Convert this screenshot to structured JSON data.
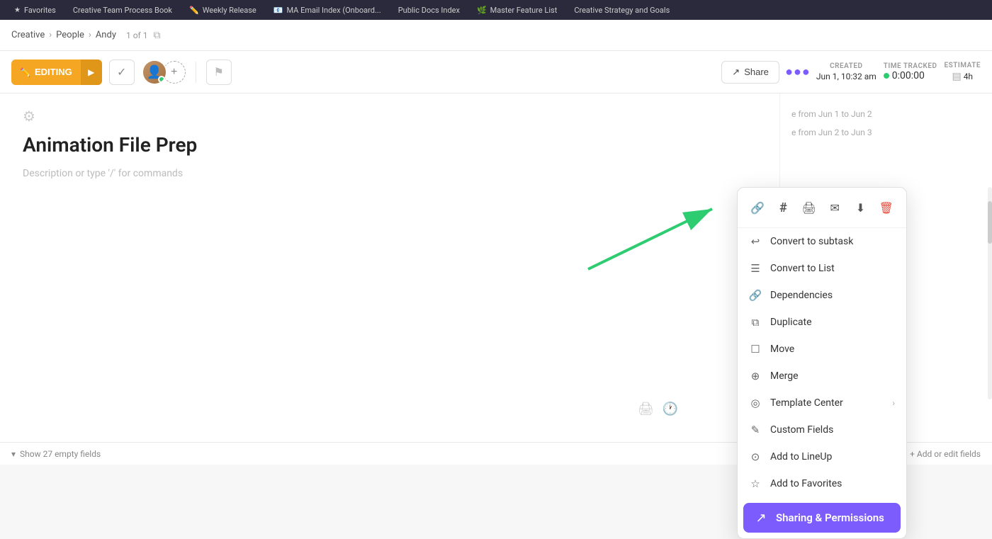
{
  "tabs": [
    {
      "label": "Favorites",
      "icon": "★"
    },
    {
      "label": "Creative Team Process Book",
      "icon": ""
    },
    {
      "label": "Weekly Release",
      "icon": "✏️"
    },
    {
      "label": "MA Email Index (Onboard...",
      "icon": "📧"
    },
    {
      "label": "Public Docs Index",
      "icon": ""
    },
    {
      "label": "Master Feature List",
      "icon": "🌿"
    },
    {
      "label": "Creative Strategy and Goals",
      "icon": ""
    }
  ],
  "breadcrumb": {
    "parts": [
      "Creative",
      "People",
      "Andy"
    ],
    "count": "1 of 1"
  },
  "toolbar": {
    "editing_label": "EDITING",
    "checkmark": "✓",
    "share_label": "Share",
    "more_dots": "•••",
    "created_label": "CREATED",
    "created_value": "Jun 1, 10:32 am",
    "time_tracked_label": "TIME TRACKED",
    "time_tracked_value": "0:00:00",
    "estimate_label": "ESTIMATE",
    "estimate_value": "4h"
  },
  "content": {
    "task_title": "Animation File Prep",
    "description_placeholder": "Description or type '/' for commands",
    "date_range_1": "e from Jun 1 to Jun 2",
    "date_range_2": "e from Jun 2 to Jun 3"
  },
  "bottom_bar": {
    "show_fields_label": "Show 27 empty fields",
    "add_fields_label": "+ Add or edit fields"
  },
  "dropdown": {
    "icons": [
      {
        "name": "link-icon",
        "symbol": "🔗"
      },
      {
        "name": "hash-icon",
        "symbol": "#"
      },
      {
        "name": "print-icon",
        "symbol": "🖨"
      },
      {
        "name": "email-icon",
        "symbol": "✉"
      },
      {
        "name": "download-icon",
        "symbol": "⬇"
      },
      {
        "name": "delete-icon",
        "symbol": "🗑",
        "is_delete": true
      }
    ],
    "items": [
      {
        "label": "Convert to subtask",
        "icon": "↩",
        "name": "convert-to-subtask"
      },
      {
        "label": "Convert to List",
        "icon": "☰",
        "name": "convert-to-list"
      },
      {
        "label": "Dependencies",
        "icon": "🔗",
        "name": "dependencies"
      },
      {
        "label": "Duplicate",
        "icon": "⧉",
        "name": "duplicate"
      },
      {
        "label": "Move",
        "icon": "☐",
        "name": "move"
      },
      {
        "label": "Merge",
        "icon": "⊕",
        "name": "merge"
      },
      {
        "label": "Template Center",
        "icon": "◎",
        "name": "template-center",
        "has_arrow": true
      },
      {
        "label": "Custom Fields",
        "icon": "✎",
        "name": "custom-fields"
      },
      {
        "label": "Add to LineUp",
        "icon": "⊙",
        "name": "add-to-lineup"
      },
      {
        "label": "Add to Favorites",
        "icon": "☆",
        "name": "add-to-favorites"
      }
    ],
    "sharing": {
      "label": "Sharing & Permissions",
      "icon": "↗"
    }
  }
}
